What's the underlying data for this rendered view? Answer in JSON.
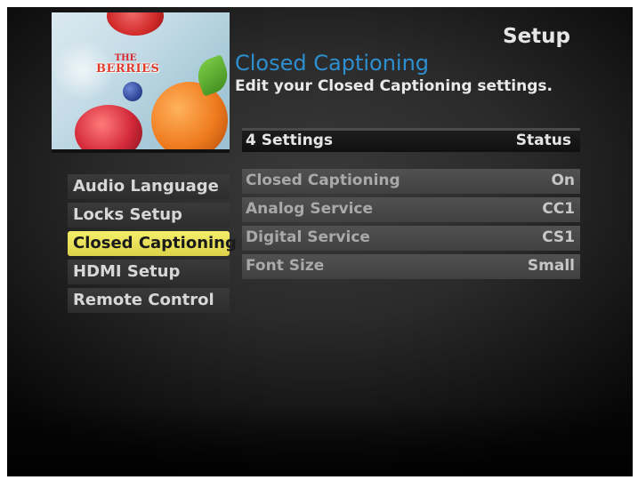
{
  "header": {
    "screen_label": "Setup",
    "title": "Closed Captioning",
    "description": "Edit your Closed Captioning settings."
  },
  "thumbnail": {
    "logo_line1": "THE",
    "logo_line2": "BERRIES"
  },
  "settings_table": {
    "count_label": "4 Settings",
    "status_label": "Status",
    "rows": [
      {
        "name": "Closed Captioning",
        "value": "On"
      },
      {
        "name": "Analog Service",
        "value": "CC1"
      },
      {
        "name": "Digital Service",
        "value": "CS1"
      },
      {
        "name": "Font Size",
        "value": "Small"
      }
    ]
  },
  "menu": {
    "selected": "Closed Captioning",
    "items": [
      {
        "label": "Audio Language"
      },
      {
        "label": "Locks Setup"
      },
      {
        "label": "Closed Captioning"
      },
      {
        "label": "HDMI Setup"
      },
      {
        "label": "Remote Control"
      }
    ]
  },
  "colors": {
    "accent_title": "#2e8fd0",
    "selection_highlight": "#eee45a",
    "background": "#2a2a2a"
  }
}
